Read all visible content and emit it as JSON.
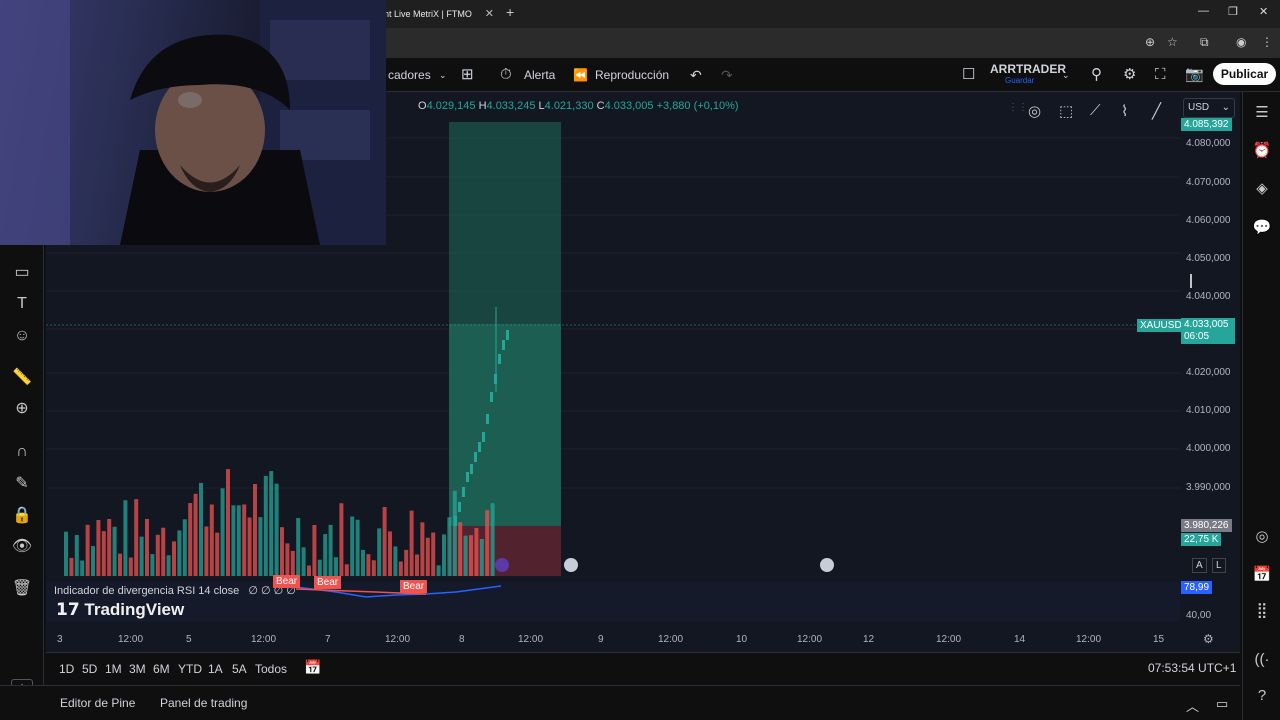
{
  "browser": {
    "tab_title": "nt Live MetriX | FTMO",
    "tab_close": "✕",
    "new_tab": "+",
    "window_controls": [
      "—",
      "❐",
      "✕"
    ]
  },
  "header": {
    "indicators_label": "cadores",
    "alert_label": "Alerta",
    "replay_label": "Reproducción",
    "layout_name": "ARRTRADER",
    "layout_sub": "Guardar",
    "publish_label": "Publicar"
  },
  "legend": {
    "open_l": "O",
    "open": "4.029,145",
    "high_l": "H",
    "high": "4.033,245",
    "low_l": "L",
    "low": "4.021,330",
    "close_l": "C",
    "close": "4.033,005",
    "change": "+3,880 (+0,10%)"
  },
  "price_axis": {
    "currency": "USD",
    "top_tag": "4.085,392",
    "labels": [
      "4.080,000",
      "4.070,000",
      "4.060,000",
      "4.050,000",
      "4.040,000",
      "4.020,000",
      "4.010,000",
      "4.000,000",
      "3.990,000"
    ],
    "symbol_tag": "XAUUSD",
    "last_price": "4.033,005",
    "countdown": "06:05",
    "stop_tag": "3.980,226",
    "volume_tag": "22,75 K",
    "rsi_value": "78,99",
    "rsi_level": "40,00",
    "auto_a": "A",
    "log_l": "L"
  },
  "rsi": {
    "title": "Indicador de divergencia RSI 14 close",
    "values": "∅ ∅ ∅ ∅",
    "bear_labels": [
      "Bear",
      "Bear",
      "Bear"
    ]
  },
  "brand": "TradingView",
  "time_axis": [
    "3",
    "12:00",
    "5",
    "12:00",
    "7",
    "12:00",
    "8",
    "12:00",
    "9",
    "12:00",
    "10",
    "12:00",
    "12",
    "12:00",
    "14",
    "12:00",
    "15"
  ],
  "timeframes": [
    "1D",
    "5D",
    "1M",
    "3M",
    "6M",
    "YTD",
    "1A",
    "5A",
    "Todos"
  ],
  "clock": "07:53:54 UTC+1",
  "bottom_panel": {
    "pine": "Editor de Pine",
    "trading": "Panel de trading"
  },
  "colors": {
    "up": "#26a69a",
    "down": "#ef5350",
    "bg": "#131722",
    "profit_zone": "#1e6b5a",
    "loss_zone": "#5a2530",
    "rsi_line": "#2962ff"
  }
}
